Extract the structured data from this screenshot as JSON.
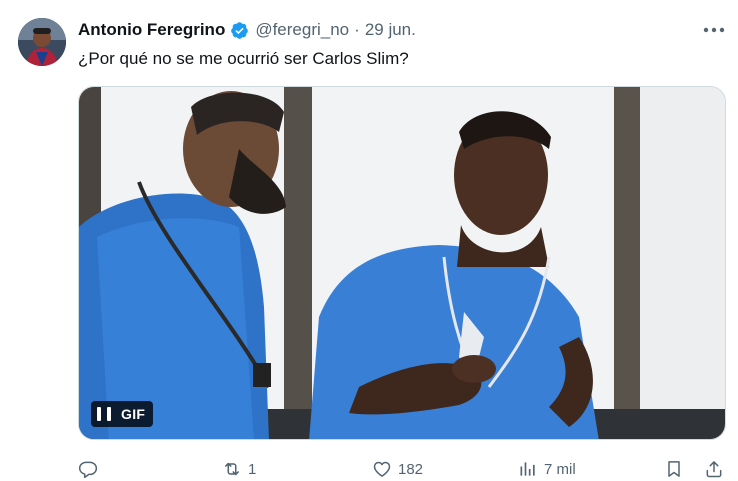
{
  "author": {
    "display_name": "Antonio Feregrino",
    "handle": "@feregri_no",
    "separator": "·",
    "date": "29 jun."
  },
  "tweet": {
    "text": "¿Por qué no se me ocurrió ser Carlos Slim?"
  },
  "media": {
    "badge_label": "GIF"
  },
  "actions": {
    "reply_count": "",
    "retweet_count": "1",
    "like_count": "182",
    "view_count": "7 mil"
  },
  "colors": {
    "verified": "#1d9bf0",
    "muted": "#536471",
    "text": "#0f1419"
  },
  "icons": [
    "more-icon",
    "verified-badge-icon",
    "pause-icon",
    "reply-icon",
    "retweet-icon",
    "like-icon",
    "views-icon",
    "bookmark-icon",
    "share-icon"
  ]
}
